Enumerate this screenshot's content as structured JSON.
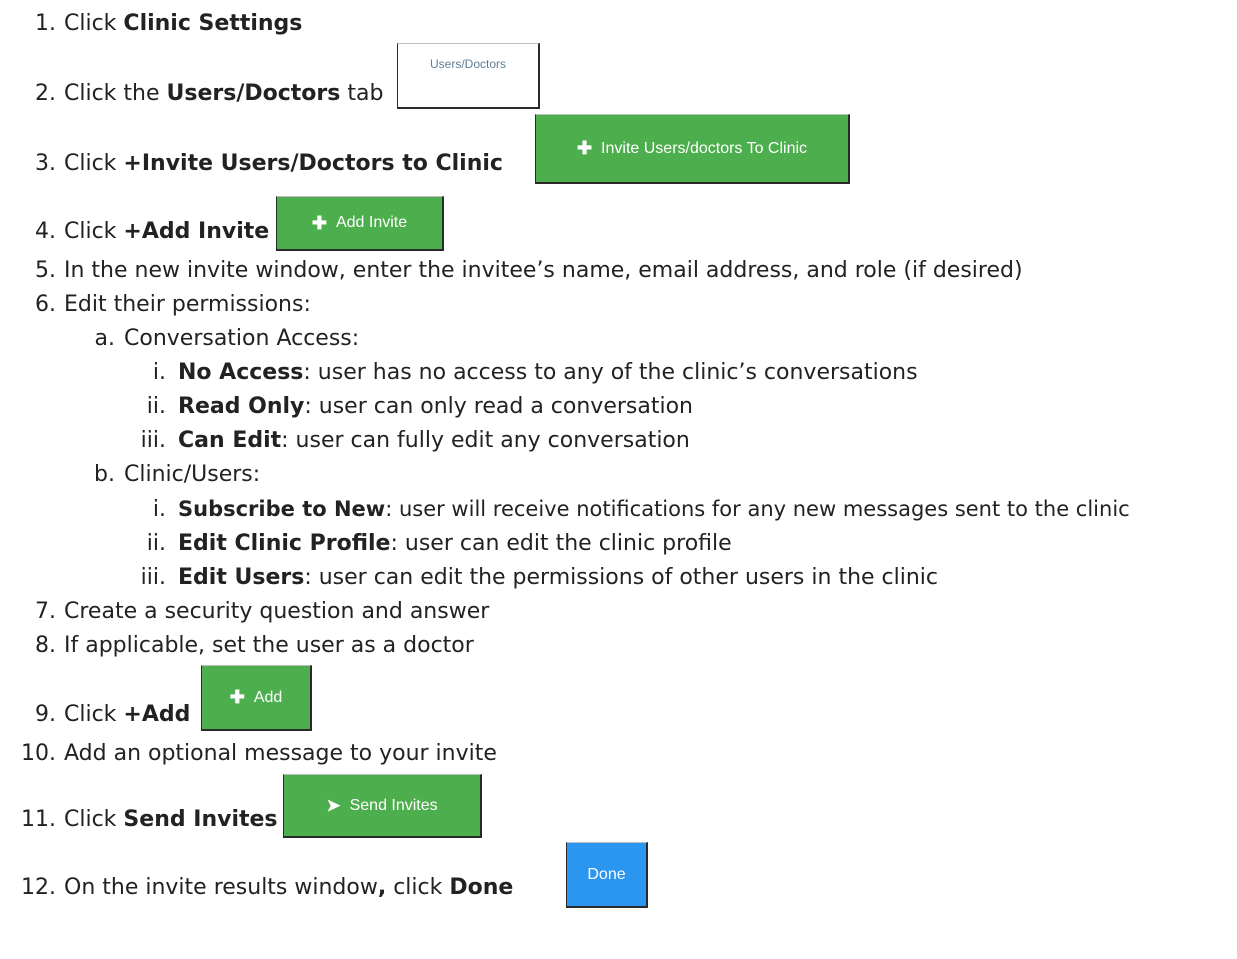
{
  "steps": [
    {
      "num": "1.",
      "pre": "Click ",
      "bold": "Clinic Settings",
      "post": ""
    },
    {
      "num": "2.",
      "pre": "Click the ",
      "bold": "Users/Doctors",
      "post": " tab"
    },
    {
      "num": "3.",
      "pre": "Click ",
      "bold": "+Invite Users/Doctors to Clinic",
      "post": ""
    },
    {
      "num": "4.",
      "pre": "Click ",
      "bold": "+Add Invite",
      "post": ""
    },
    {
      "num": "5.",
      "pre": "In the new invite window, enter the invitee’s name, email address, and role (if desired)",
      "bold": "",
      "post": ""
    },
    {
      "num": "6.",
      "pre": "Edit their permissions:",
      "bold": "",
      "post": ""
    },
    {
      "num": "a.",
      "pre": "Conversation Access:",
      "bold": "",
      "post": ""
    },
    {
      "num": "i.",
      "pre": "",
      "bold": "No Access",
      "post": ": user has no access to any of the clinic’s conversations"
    },
    {
      "num": "ii.",
      "pre": "",
      "bold": "Read Only",
      "post": ": user can only read a conversation"
    },
    {
      "num": "iii.",
      "pre": "",
      "bold": "Can Edit",
      "post": ": user can fully edit any conversation"
    },
    {
      "num": "b.",
      "pre": "Clinic/Users:",
      "bold": "",
      "post": ""
    },
    {
      "num": "i.",
      "pre": "",
      "bold": "Subscribe to New",
      "post": ": user will receive notifications for any new messages sent to the clinic"
    },
    {
      "num": "ii.",
      "pre": "",
      "bold": "Edit Clinic Profile",
      "post": ": user can edit the clinic profile"
    },
    {
      "num": "iii.",
      "pre": "",
      "bold": "Edit Users",
      "post": ": user can edit the permissions of other users in the clinic"
    },
    {
      "num": "7.",
      "pre": "Create a security question and answer",
      "bold": "",
      "post": ""
    },
    {
      "num": "8.",
      "pre": "If applicable, set the user as a doctor",
      "bold": "",
      "post": ""
    },
    {
      "num": "9.",
      "pre": "Click ",
      "bold": "+Add",
      "post": ""
    },
    {
      "num": "10.",
      "pre": "Add an optional message to your invite",
      "bold": "",
      "post": ""
    },
    {
      "num": "11.",
      "pre": "Click ",
      "bold": "Send Invites",
      "post": ""
    },
    {
      "num": "12.",
      "pre": "On the invite results window",
      "bold": ",",
      "post": " click ",
      "bold2": "Done"
    }
  ],
  "buttons": {
    "users_doctors_tab": "Users/Doctors",
    "invite_users": "Invite Users/doctors To Clinic",
    "add_invite": "Add Invite",
    "add": "Add",
    "send_invites": "Send Invites",
    "done": "Done"
  },
  "icons": {
    "plus": "plus-icon",
    "send": "paper-plane-icon"
  },
  "colors": {
    "green_button": "#4cae4c",
    "blue_button": "#2b96f0",
    "tab_text": "#5f7d95"
  }
}
